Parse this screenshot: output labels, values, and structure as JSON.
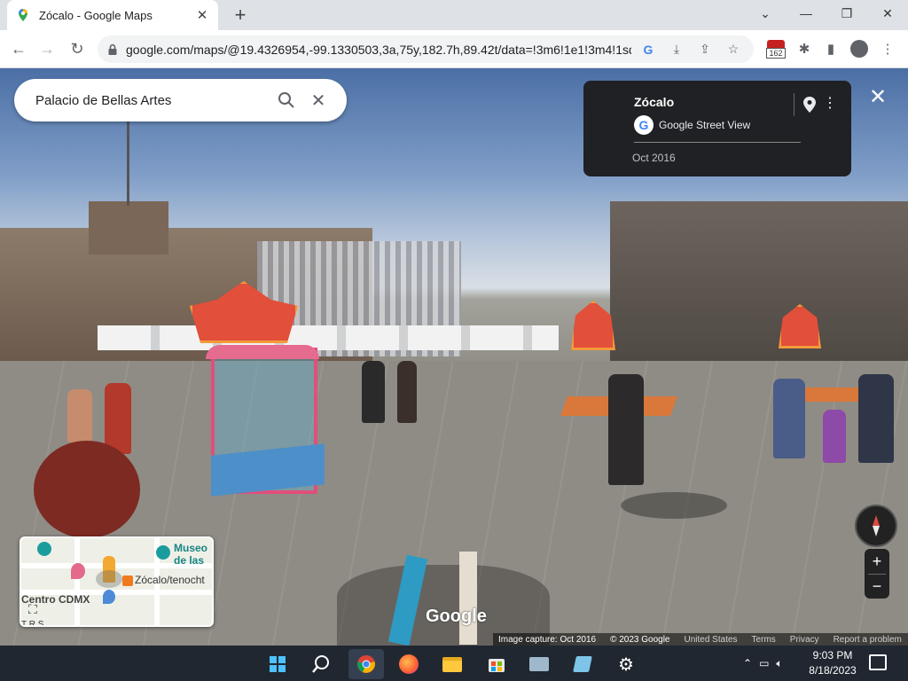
{
  "browser": {
    "tab_title": "Zócalo - Google Maps",
    "tab_close": "✕",
    "new_tab": "+",
    "url": "google.com/maps/@19.4326954,-99.1330503,3a,75y,182.7h,89.42t/data=!3m6!1e1!3m4!1sd...",
    "extension_badge": "162"
  },
  "search": {
    "query": "Palacio de Bellas Artes"
  },
  "info_card": {
    "place": "Zócalo",
    "source": "Google Street View",
    "date": "Oct 2016"
  },
  "minimap": {
    "labels": {
      "museo_line1": "Museo",
      "museo_line2": "de las",
      "zocalo": "Zócalo/tenocht",
      "centro": "Centro CDMX",
      "bottom": "T R S"
    }
  },
  "branding": {
    "logo": "Google"
  },
  "footer": {
    "capture": "Image capture: Oct 2016",
    "copyright": "© 2023 Google",
    "country": "United States",
    "terms": "Terms",
    "privacy": "Privacy",
    "report": "Report a problem"
  },
  "zoom": {
    "plus": "+",
    "minus": "−"
  },
  "taskbar": {
    "time": "9:03 PM",
    "date": "8/18/2023"
  },
  "colors": {
    "google_blue": "#4285f4",
    "taskbar_bg": "#202731",
    "info_card_bg": "#202124"
  }
}
